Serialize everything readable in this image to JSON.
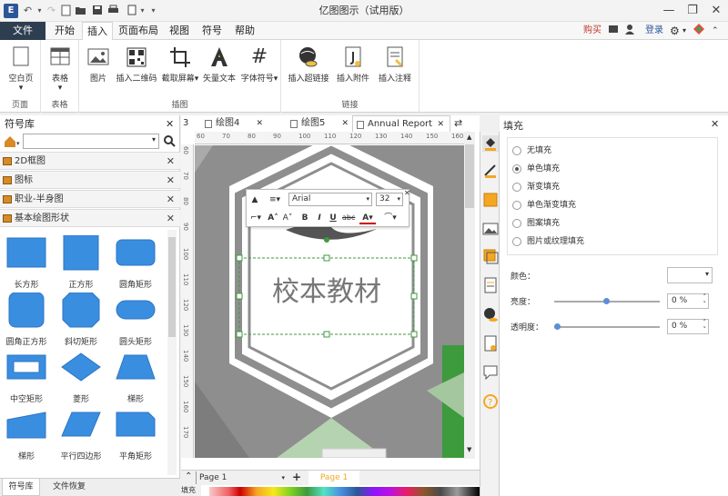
{
  "app": {
    "title": "亿图图示（试用版）"
  },
  "ribbon_tabs": [
    "文件",
    "开始",
    "插入",
    "页面布局",
    "视图",
    "符号",
    "帮助"
  ],
  "ribbon_right": {
    "buy": "购买",
    "login": "登录"
  },
  "ribbon_groups": [
    {
      "label": "页面",
      "buttons": [
        "空白页"
      ]
    },
    {
      "label": "表格",
      "buttons": [
        "表格"
      ]
    },
    {
      "label": "插图",
      "buttons": [
        "图片",
        "插入二维码",
        "截取屏幕",
        "矢量文本",
        "字体符号"
      ]
    },
    {
      "label": "链接",
      "buttons": [
        "插入超链接",
        "插入附件",
        "插入注释"
      ]
    }
  ],
  "left_panel": {
    "title": "符号库",
    "search_placeholder": "",
    "categories": [
      "2D框图",
      "图标",
      "职业-半身图",
      "基本绘图形状"
    ],
    "shapes": [
      "长方形",
      "正方形",
      "圆角矩形",
      "圆角正方形",
      "斜切矩形",
      "圆头矩形",
      "中空矩形",
      "菱形",
      "梯形",
      "梯形",
      "平行四边形",
      "平角矩形"
    ],
    "bottom_tabs": [
      "符号库",
      "文件恢复"
    ]
  },
  "doc_tabs": [
    "3",
    "绘图4",
    "绘图5",
    "Annual Report"
  ],
  "canvas": {
    "text": "校本教材",
    "font_name": "Arial",
    "font_size": "32",
    "ruler_top": [
      "60",
      "70",
      "80",
      "90",
      "100",
      "110",
      "120",
      "130",
      "140",
      "150",
      "160"
    ],
    "ruler_left": [
      "60",
      "70",
      "80",
      "90",
      "100",
      "110",
      "120",
      "130",
      "140",
      "150",
      "160",
      "170",
      "180"
    ]
  },
  "page_bar": {
    "page_select": "Page 1",
    "page_tab": "Page 1",
    "fill_label": "填充"
  },
  "fill_panel": {
    "title": "填充",
    "options": [
      "无填充",
      "单色填充",
      "渐变填充",
      "单色渐变填充",
      "图案填充",
      "图片或纹理填充"
    ],
    "selected": "单色填充",
    "color_label": "颜色：",
    "brightness_label": "亮度：",
    "brightness_value": "0 %",
    "transparency_label": "透明度：",
    "transparency_value": "0 %"
  },
  "colors": {
    "accent": "#2d3e50",
    "shape_blue": "#3a8ee0",
    "hex_gray": "#8e8e8e",
    "green": "#3d9a3d",
    "active_tab": "#f5a623"
  }
}
